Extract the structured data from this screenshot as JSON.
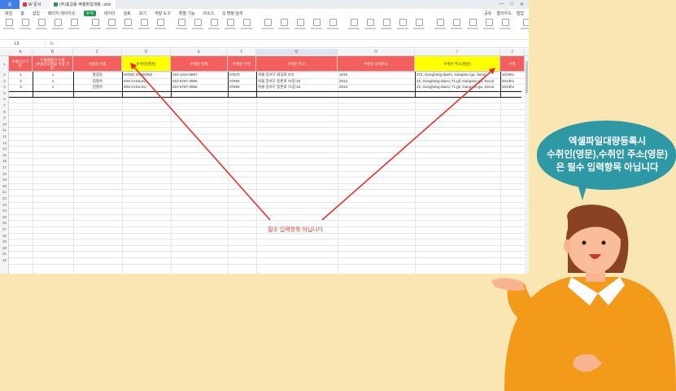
{
  "titlebar": {
    "home_tab": "홈",
    "doc_tab": "W 문서",
    "active_tab": "(주)홍길동 엑셀파일대량...xlsx",
    "window_controls": [
      "—",
      "□",
      "✕"
    ]
  },
  "menubar": {
    "items": [
      "파일",
      "홈",
      "삽입",
      "페이지 레이아웃",
      "수식",
      "데이터",
      "검토",
      "보기",
      "개발 도구",
      "특별 기능",
      "리소스",
      "Q 명령 검색"
    ],
    "active_index": 4,
    "right_items": [
      "공유",
      "클라우드",
      "협업"
    ]
  },
  "formulabar": {
    "name_box": "L5",
    "fx": "fx"
  },
  "sheet": {
    "columns": [
      "A",
      "B",
      "C",
      "D",
      "E",
      "F",
      "G",
      "H",
      "I",
      "J"
    ],
    "selected_column": "G",
    "header_row": [
      "수출신고구분",
      "수출물품의 수량\n(수출신고필증 수량 기준)",
      "수출자 이름",
      "수취인(영문)",
      "수취인 전화",
      "수취인 우편",
      "수취인 주소",
      "수취인 상세주소",
      "수취인 주소(영문)",
      "수취"
    ],
    "rows": [
      [
        "1",
        "1",
        "홍길동",
        "HONG GILDONG",
        "010-1234-5687",
        "07570",
        "서울 강서구 화곡로 372",
        "1019",
        "372, Gonghang-daero, Gangseo-gu, Seoul",
        "1019ho"
      ],
      [
        "2",
        "1",
        "김철수",
        "KIM CHULSU",
        "010-5787-3956",
        "07590",
        "서울 강서구 등촌로 71길 22",
        "2013",
        "22, Gonghang-daero 71-gil, Gangseo-gu, Seoul",
        "2013ho"
      ],
      [
        "3",
        "1",
        "김철수",
        "KIM CHULSU",
        "010-5787-3956",
        "07590",
        "서울 강서구 등촌로 71길 22",
        "2013",
        "22, Gonghang-daero 71-gil, Gangseo-gu, Seoul",
        "2013ho"
      ]
    ],
    "row_numbers": [
      "1",
      "2",
      "3",
      "4",
      "5",
      "6",
      "7",
      "8",
      "9",
      "10",
      "11",
      "12",
      "13",
      "14",
      "15",
      "16",
      "17",
      "18",
      "19",
      "20",
      "21",
      "22",
      "23",
      "24",
      "25",
      "26",
      "27",
      "28",
      "29",
      "30",
      "31",
      "32"
    ]
  },
  "annotation": {
    "note": "필수 입력항목 아닙니다"
  },
  "speech_bubble": {
    "line1": "엑셀파일대량등록시",
    "line2": "수취인(영문),수취인 주소(영문)",
    "line3": "은  필수 입력항목 아닙니다"
  },
  "colors": {
    "header_red": "#f25f5c",
    "header_yellow": "#ffff00",
    "arrow": "#e5302b",
    "bubble": "#2e98a4",
    "background": "#f9e6b3"
  }
}
